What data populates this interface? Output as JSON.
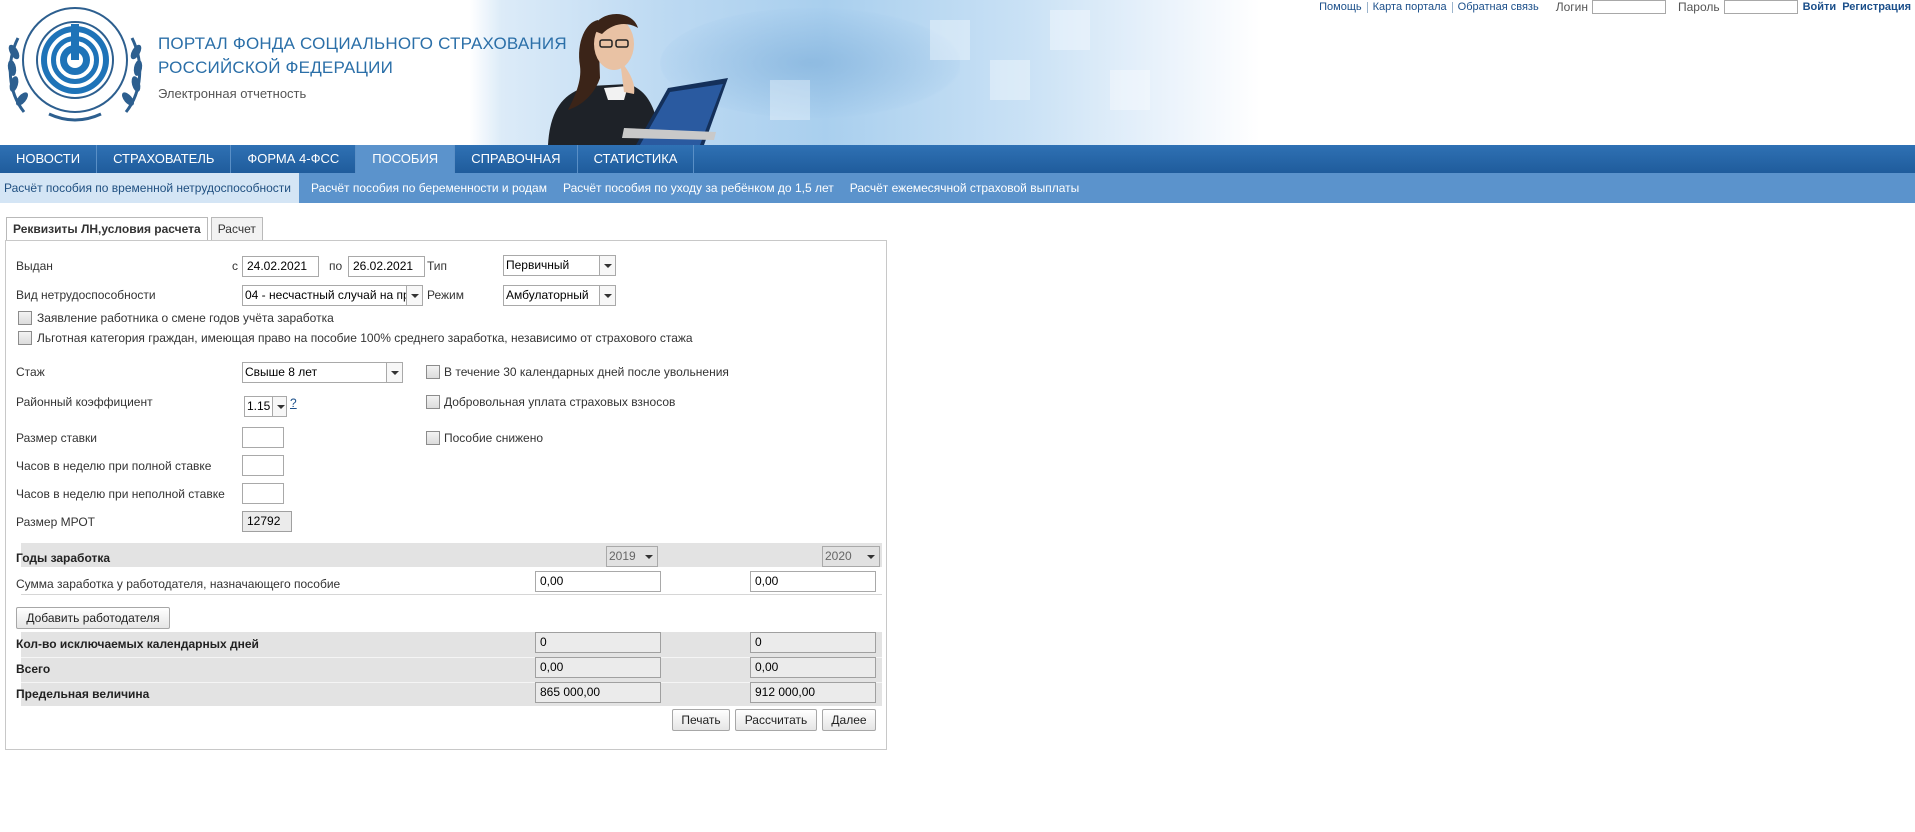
{
  "header": {
    "title_line1": "ПОРТАЛ ФОНДА СОЦИАЛЬНОГО СТРАХОВАНИЯ",
    "title_line2": "РОССИЙСКОЙ ФЕДЕРАЦИИ",
    "subtitle": "Электронная отчетность",
    "logo_text": "ФОНД СОЦИАЛЬНОГО СТРАХОВАНИЯ РОССИЙСКОЙ ФЕДЕРАЦИИ"
  },
  "toplinks": {
    "help": "Помощь",
    "sitemap": "Карта портала",
    "feedback": "Обратная связь",
    "login_label": "Логин",
    "password_label": "Пароль",
    "login_value": "",
    "password_value": "",
    "signin": "Войти",
    "register": "Регистрация"
  },
  "nav": {
    "items": [
      "НОВОСТИ",
      "СТРАХОВАТЕЛЬ",
      "ФОРМА 4-ФСС",
      "ПОСОБИЯ",
      "СПРАВОЧНАЯ",
      "СТАТИСТИКА"
    ],
    "active": "ПОСОБИЯ"
  },
  "subnav": {
    "items": [
      "Расчёт пособия по временной нетрудоспособности",
      "Расчёт пособия по беременности и родам",
      "Расчёт пособия по уходу за ребёнком до 1,5 лет",
      "Расчёт ежемесячной страховой выплаты"
    ]
  },
  "tabs": [
    "Реквизиты ЛН,условия расчета",
    "Расчет"
  ],
  "form": {
    "issued_label": "Выдан",
    "from_label": "с",
    "from_value": "24.02.2021",
    "to_label": "по",
    "to_value": "26.02.2021",
    "type_label": "Тип",
    "type_value": "Первичный",
    "disability_label": "Вид нетрудоспособности",
    "disability_value": "04 - несчастный случай на пр",
    "mode_label": "Режим",
    "mode_value": "Амбулаторный",
    "check_years_change": "Заявление работника о смене годов учёта заработка",
    "check_privileged": "Льготная категория граждан, имеющая право на пособие 100% среднего заработка, независимо от страхового стажа",
    "experience_label": "Стаж",
    "experience_value": "Свыше 8 лет",
    "check_30days": "В течение 30 календарных дней после увольнения",
    "regional_label": "Районный коэффициент",
    "regional_value": "1.15",
    "help_link": "?",
    "check_voluntary": "Добровольная уплата страховых взносов",
    "rate_label": "Размер ставки",
    "rate_value": "",
    "check_reduced": "Пособие снижено",
    "full_hours_label": "Часов в неделю при полной ставке",
    "full_hours_value": "",
    "part_hours_label": "Часов в неделю при неполной ставке",
    "part_hours_value": "",
    "mrot_label": "Размер МРОТ",
    "mrot_value": "12792"
  },
  "earnings": {
    "years_label": "Годы заработка",
    "year1": "2019",
    "year2": "2020",
    "sum_label": "Сумма заработка у работодателя, назначающего пособие",
    "sum1": "0,00",
    "sum2": "0,00",
    "add_employer": "Добавить работодателя",
    "excluded_label": "Кол-во исключаемых календарных дней",
    "excluded1": "0",
    "excluded2": "0",
    "total_label": "Всего",
    "total1": "0,00",
    "total2": "0,00",
    "limit_label": "Предельная величина",
    "limit1": "865 000,00",
    "limit2": "912 000,00"
  },
  "buttons": {
    "print": "Печать",
    "calculate": "Рассчитать",
    "next": "Далее"
  },
  "colors": {
    "nav_blue": "#2f71b4",
    "subnav_blue": "#5b93cc",
    "title_blue": "#2b6fa8",
    "link_blue": "#1b4f8a"
  }
}
